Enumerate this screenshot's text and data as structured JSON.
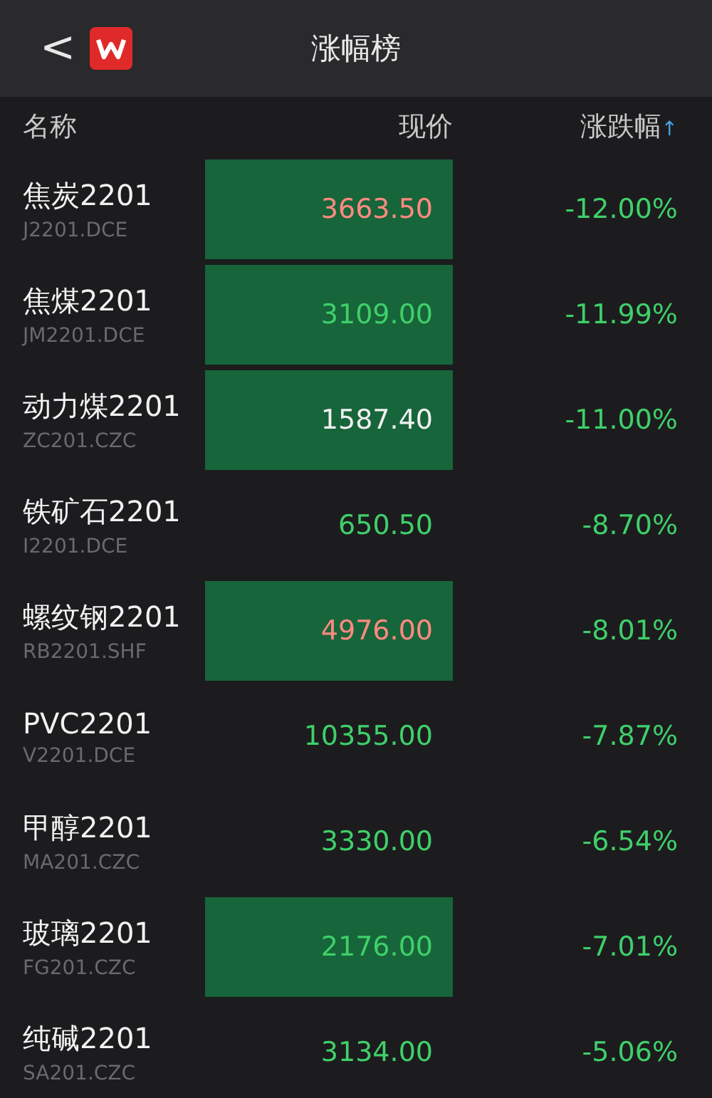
{
  "header": {
    "back_icon": "<",
    "title": "涨幅榜"
  },
  "table": {
    "columns": [
      {
        "label": "名称"
      },
      {
        "label": "现价"
      },
      {
        "label": "涨跌幅",
        "sort_arrow": "↑"
      }
    ],
    "rows": [
      {
        "name": "焦炭2201",
        "code": "J2201.DCE",
        "price": "3663.50",
        "highlighted": true,
        "color": "#ff8a80",
        "change": "-12.00%"
      },
      {
        "name": "焦煤2201",
        "code": "JM2201.DCE",
        "price": "3109.00",
        "highlighted": true,
        "color": "#3fcf6a",
        "change": "-11.99%"
      },
      {
        "name": "动力煤2201",
        "code": "ZC201.CZC",
        "price": "1587.40",
        "highlighted": true,
        "color": "#f0f0f0",
        "change": "-11.00%"
      },
      {
        "name": "铁矿石2201",
        "code": "I2201.DCE",
        "price": "650.50",
        "highlighted": false,
        "color": "#3fcf6a",
        "change": "-8.70%"
      },
      {
        "name": "螺纹钢2201",
        "code": "RB2201.SHF",
        "price": "4976.00",
        "highlighted": true,
        "color": "#ff8a80",
        "change": "-8.01%"
      },
      {
        "name": "PVC2201",
        "code": "V2201.DCE",
        "price": "10355.00",
        "highlighted": false,
        "color": "#3fcf6a",
        "change": "-7.87%"
      },
      {
        "name": "甲醇2201",
        "code": "MA201.CZC",
        "price": "3330.00",
        "highlighted": false,
        "color": "#3fcf6a",
        "change": "-6.54%"
      },
      {
        "name": "玻璃2201",
        "code": "FG201.CZC",
        "price": "2176.00",
        "highlighted": true,
        "color": "#3fcf6a",
        "change": "-7.01%"
      },
      {
        "name": "纯碱2201",
        "code": "SA201.CZC",
        "price": "3134.00",
        "highlighted": false,
        "color": "#3fcf6a",
        "change": "-5.06%"
      }
    ]
  }
}
